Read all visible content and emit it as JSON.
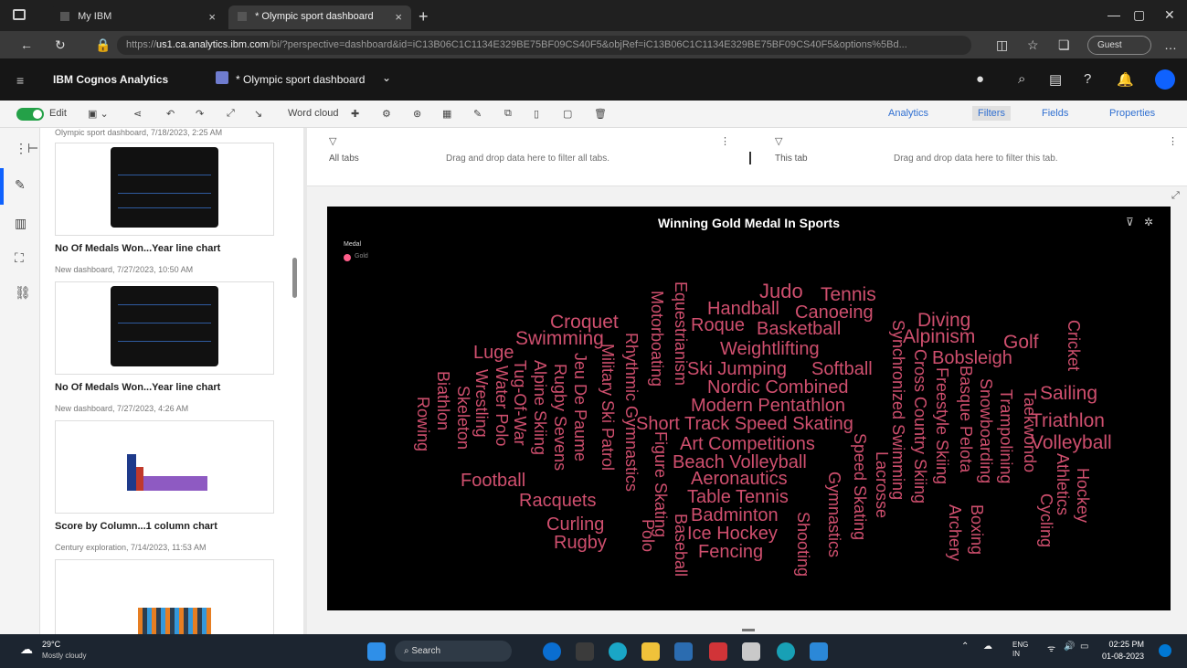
{
  "browser": {
    "tabs": [
      {
        "label": "My IBM"
      },
      {
        "label": "* Olympic sport dashboard"
      }
    ],
    "url": {
      "prefix": "https://",
      "host": "us1.ca.analytics.ibm.com",
      "rest": "/bi/?perspective=dashboard&id=iC13B06C1C1134E329BE75BF09CS40F5&objRef=iC13B06C1C1134E329BE75BF09CS40F5&options%5Bd..."
    },
    "profile_label": "Guest"
  },
  "app": {
    "brand": "IBM Cognos Analytics",
    "dashboard_title": "* Olympic sport dashboard"
  },
  "toolbar": {
    "edit_label": "Edit",
    "viz_label": "Word cloud",
    "right": [
      "Analytics",
      "Filters",
      "Fields",
      "Properties"
    ]
  },
  "left_panel": {
    "cards": [
      {
        "meta": "Olympic sport dashboard, 7/18/2023, 2:25 AM",
        "title": "",
        "thumb": "dark-line"
      },
      {
        "meta": "New dashboard, 7/27/2023, 10:50 AM",
        "title": "No Of Medals Won...Year line chart",
        "thumb": "dark-line"
      },
      {
        "meta": "New dashboard, 7/27/2023, 4:26 AM",
        "title": "No Of Medals Won...Year line chart",
        "thumb": "bar"
      },
      {
        "meta": "Century exploration, 7/14/2023, 11:53 AM",
        "title": "Score by Column...1 column chart",
        "thumb": "bar2"
      }
    ]
  },
  "filters": {
    "all_tabs_label": "All tabs",
    "all_tabs_hint": "Drag and drop data here to filter all tabs.",
    "this_tab_label": "This tab",
    "this_tab_hint": "Drag and drop data here to filter this tab."
  },
  "wordcloud": {
    "title": "Winning Gold Medal In Sports",
    "legend_title": "Medal",
    "legend_item": "Gold",
    "color": "#cf4f6e",
    "words": [
      "Judo",
      "Tennis",
      "Handball",
      "Canoeing",
      "Roque",
      "Basketball",
      "Croquet",
      "Swimming",
      "Diving",
      "Alpinism",
      "Golf",
      "Weightlifting",
      "Ski Jumping",
      "Softball",
      "Bobsleigh",
      "Luge",
      "Nordic Combined",
      "Modern Pentathlon",
      "Short Track Speed Skating",
      "Sailing",
      "Triathlon",
      "Volleyball",
      "Art Competitions",
      "Beach Volleyball",
      "Aeronautics",
      "Table Tennis",
      "Badminton",
      "Ice Hockey",
      "Fencing",
      "Football",
      "Racquets",
      "Curling",
      "Rugby",
      "Rowing",
      "Biathlon",
      "Skeleton",
      "Wrestling",
      "Water Polo",
      "Tug-Of-War",
      "Alpine Skiing",
      "Rugby Sevens",
      "Jeu De Paume",
      "Military Ski Patrol",
      "Rhythmic Gymnastics",
      "Motorboating",
      "Equestrianism",
      "Figure Skating",
      "Polo",
      "Baseball",
      "Shooting",
      "Gymnastics",
      "Speed Skating",
      "Lacrosse",
      "Synchronized Swimming",
      "Cross Country Skiing",
      "Freestyle Skiing",
      "Basque Pelota",
      "Archery",
      "Boxing",
      "Snowboarding",
      "Trampolining",
      "Taekwondo",
      "Cycling",
      "Athletics",
      "Hockey",
      "Cricket"
    ]
  },
  "taskbar": {
    "weather_temp": "29°C",
    "weather_desc": "Mostly cloudy",
    "search_label": "Search",
    "lang": "ENG",
    "region": "IN",
    "time": "02:25 PM",
    "date": "01-08-2023"
  }
}
